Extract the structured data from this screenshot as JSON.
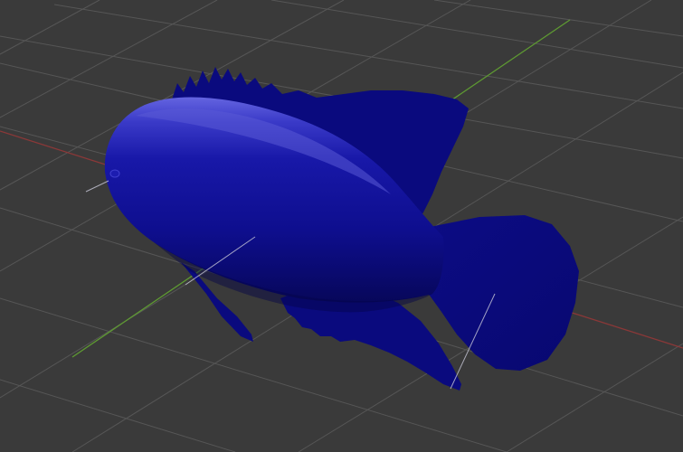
{
  "viewport": {
    "background": "#3a3a3a",
    "grid_color": "#565656",
    "x_axis_color": "#8a3838",
    "y_axis_color": "#5e9a32",
    "normal_line_color": "#c8c8d8"
  },
  "model": {
    "icon": "fish-mesh-icon",
    "body_color": "#12129a",
    "fin_color": "#0a0a7e",
    "highlight_color": "#5a5ad6",
    "shadow_color": "#05054a"
  }
}
